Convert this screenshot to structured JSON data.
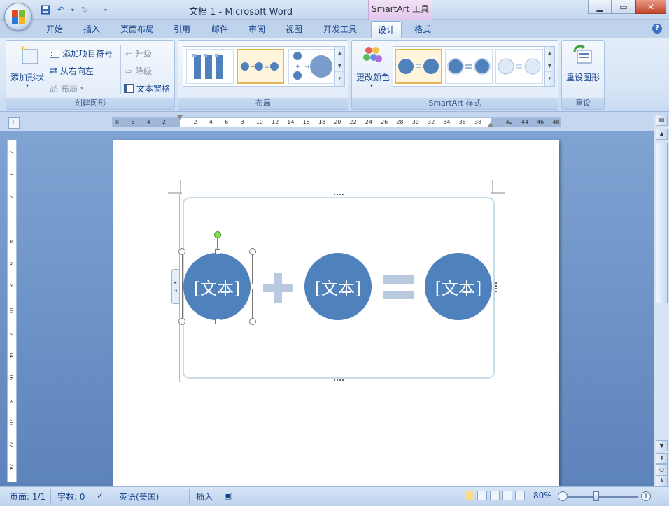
{
  "window": {
    "title": "文档 1 - Microsoft Word",
    "context_tab": "SmartArt 工具"
  },
  "tabs": [
    "开始",
    "插入",
    "页面布局",
    "引用",
    "邮件",
    "审阅",
    "视图",
    "开发工具",
    "设计",
    "格式"
  ],
  "active_tab": "设计",
  "ribbon": {
    "create_graphic": {
      "label": "创建图形",
      "add_shape": "添加形状",
      "add_bullet": "添加项目符号",
      "right_to_left": "从右向左",
      "layout": "布局",
      "promote": "升级",
      "demote": "降级",
      "text_pane": "文本窗格"
    },
    "layouts": {
      "label": "布局"
    },
    "styles": {
      "label": "SmartArt 样式",
      "change_colors": "更改颜色"
    },
    "reset": {
      "label": "重设",
      "reset_graphic": "重设图形"
    }
  },
  "ruler": {
    "ticks": [
      "8",
      "6",
      "4",
      "2",
      "",
      "2",
      "4",
      "6",
      "8",
      "10",
      "12",
      "14",
      "16",
      "18",
      "20",
      "22",
      "24",
      "26",
      "28",
      "30",
      "32",
      "34",
      "36",
      "38",
      "",
      "42",
      "44",
      "46",
      "48"
    ],
    "vticks": [
      "2",
      "1",
      "2",
      "1",
      "4",
      "6",
      "8",
      "10",
      "12",
      "14",
      "16",
      "18",
      "20",
      "22",
      "24"
    ]
  },
  "smartart": {
    "nodes": [
      {
        "text": "[文本]"
      },
      {
        "text": "[文本]"
      },
      {
        "text": "[文本]"
      }
    ],
    "circle_color": "#4f81bd",
    "operator_color": "#b9c9e0"
  },
  "statusbar": {
    "page": "页面: 1/1",
    "words": "字数: 0",
    "language": "英语(美国)",
    "mode": "插入",
    "zoom": "80%"
  }
}
